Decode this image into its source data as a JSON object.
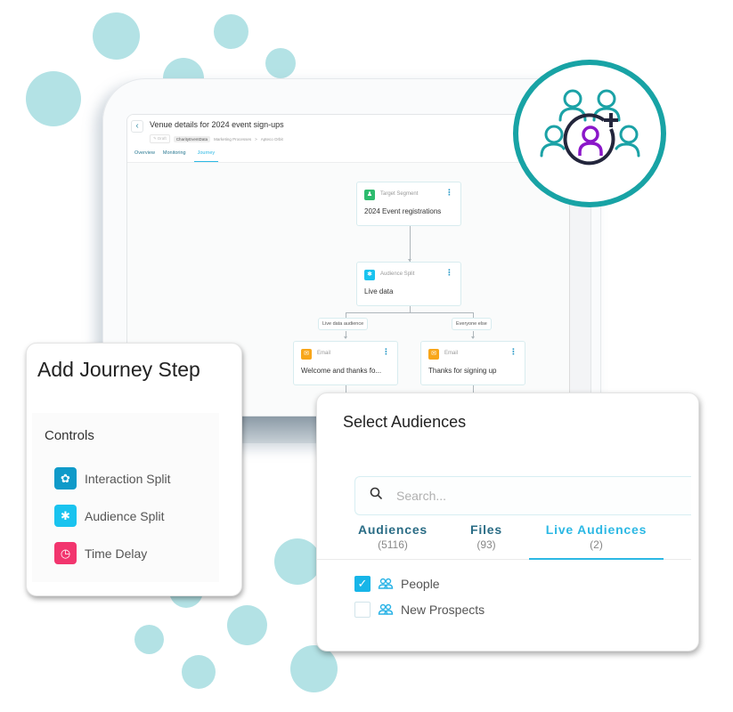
{
  "tablet": {
    "page_title": "Venue details for 2024 event sign-ups",
    "back_icon": "chevron-left-icon",
    "status": "Draft",
    "data_source": "CharityEventData",
    "breadcrumb": [
      "Marketing Processes",
      ">",
      "Apteco Orbit"
    ],
    "tabs": [
      {
        "label": "Overview",
        "active": false
      },
      {
        "label": "Monitoring",
        "active": false
      },
      {
        "label": "Journey",
        "active": true
      }
    ],
    "journey": {
      "nodes": [
        {
          "type": "Target Segment",
          "name": "2024 Event registrations",
          "icon": "segment-icon",
          "color": "#2dbb6e"
        },
        {
          "type": "Audience Split",
          "name": "Live data",
          "icon": "audience-split-icon",
          "color": "#19c3ef"
        },
        {
          "type": "Email",
          "name": "Welcome and thanks fo...",
          "icon": "email-icon",
          "color": "#f8a61a"
        },
        {
          "type": "Email",
          "name": "Thanks for signing up",
          "icon": "email-icon",
          "color": "#f8a61a"
        }
      ],
      "branch_labels": [
        "Live data audience",
        "Everyone else"
      ]
    }
  },
  "badge": {
    "icon": "add-audience-icon",
    "ring_color": "#18a3a5",
    "accent_color": "#8b17c9"
  },
  "add_step": {
    "title": "Add Journey Step",
    "section": "Controls",
    "items": [
      {
        "label": "Interaction Split",
        "icon": "interaction-split-icon",
        "color": "#0f9ac9"
      },
      {
        "label": "Audience Split",
        "icon": "audience-split-icon",
        "color": "#19c3ef"
      },
      {
        "label": "Time Delay",
        "icon": "clock-icon",
        "color": "#f2356e"
      }
    ]
  },
  "select_audiences": {
    "title": "Select Audiences",
    "search_placeholder": "Search...",
    "tabs": [
      {
        "label": "Audiences",
        "count": "(5116)",
        "active": false
      },
      {
        "label": "Files",
        "count": "(93)",
        "active": false
      },
      {
        "label": "Live Audiences",
        "count": "(2)",
        "active": true
      }
    ],
    "items": [
      {
        "label": "People",
        "checked": true
      },
      {
        "label": "New Prospects",
        "checked": false
      }
    ]
  }
}
